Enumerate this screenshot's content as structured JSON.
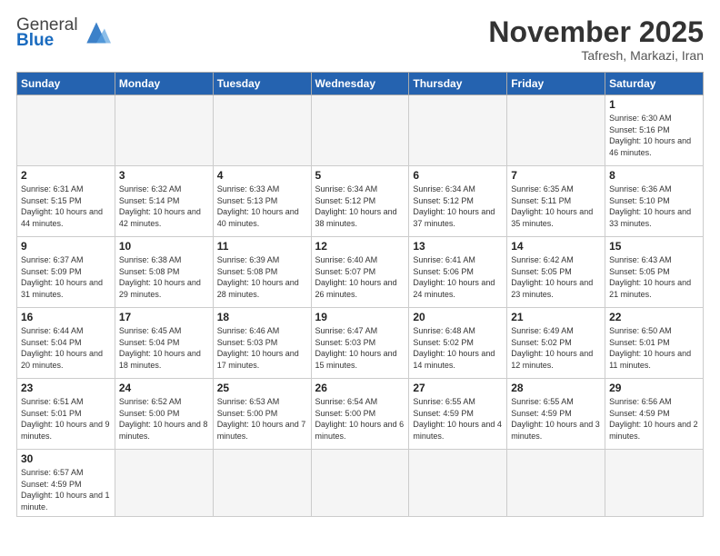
{
  "header": {
    "logo": {
      "general": "General",
      "blue": "Blue"
    },
    "month": "November 2025",
    "location": "Tafresh, Markazi, Iran"
  },
  "weekdays": [
    "Sunday",
    "Monday",
    "Tuesday",
    "Wednesday",
    "Thursday",
    "Friday",
    "Saturday"
  ],
  "weeks": [
    [
      {
        "day": "",
        "info": ""
      },
      {
        "day": "",
        "info": ""
      },
      {
        "day": "",
        "info": ""
      },
      {
        "day": "",
        "info": ""
      },
      {
        "day": "",
        "info": ""
      },
      {
        "day": "",
        "info": ""
      },
      {
        "day": "1",
        "info": "Sunrise: 6:30 AM\nSunset: 5:16 PM\nDaylight: 10 hours\nand 46 minutes."
      }
    ],
    [
      {
        "day": "2",
        "info": "Sunrise: 6:31 AM\nSunset: 5:15 PM\nDaylight: 10 hours\nand 44 minutes."
      },
      {
        "day": "3",
        "info": "Sunrise: 6:32 AM\nSunset: 5:14 PM\nDaylight: 10 hours\nand 42 minutes."
      },
      {
        "day": "4",
        "info": "Sunrise: 6:33 AM\nSunset: 5:13 PM\nDaylight: 10 hours\nand 40 minutes."
      },
      {
        "day": "5",
        "info": "Sunrise: 6:34 AM\nSunset: 5:12 PM\nDaylight: 10 hours\nand 38 minutes."
      },
      {
        "day": "6",
        "info": "Sunrise: 6:34 AM\nSunset: 5:12 PM\nDaylight: 10 hours\nand 37 minutes."
      },
      {
        "day": "7",
        "info": "Sunrise: 6:35 AM\nSunset: 5:11 PM\nDaylight: 10 hours\nand 35 minutes."
      },
      {
        "day": "8",
        "info": "Sunrise: 6:36 AM\nSunset: 5:10 PM\nDaylight: 10 hours\nand 33 minutes."
      }
    ],
    [
      {
        "day": "9",
        "info": "Sunrise: 6:37 AM\nSunset: 5:09 PM\nDaylight: 10 hours\nand 31 minutes."
      },
      {
        "day": "10",
        "info": "Sunrise: 6:38 AM\nSunset: 5:08 PM\nDaylight: 10 hours\nand 29 minutes."
      },
      {
        "day": "11",
        "info": "Sunrise: 6:39 AM\nSunset: 5:08 PM\nDaylight: 10 hours\nand 28 minutes."
      },
      {
        "day": "12",
        "info": "Sunrise: 6:40 AM\nSunset: 5:07 PM\nDaylight: 10 hours\nand 26 minutes."
      },
      {
        "day": "13",
        "info": "Sunrise: 6:41 AM\nSunset: 5:06 PM\nDaylight: 10 hours\nand 24 minutes."
      },
      {
        "day": "14",
        "info": "Sunrise: 6:42 AM\nSunset: 5:05 PM\nDaylight: 10 hours\nand 23 minutes."
      },
      {
        "day": "15",
        "info": "Sunrise: 6:43 AM\nSunset: 5:05 PM\nDaylight: 10 hours\nand 21 minutes."
      }
    ],
    [
      {
        "day": "16",
        "info": "Sunrise: 6:44 AM\nSunset: 5:04 PM\nDaylight: 10 hours\nand 20 minutes."
      },
      {
        "day": "17",
        "info": "Sunrise: 6:45 AM\nSunset: 5:04 PM\nDaylight: 10 hours\nand 18 minutes."
      },
      {
        "day": "18",
        "info": "Sunrise: 6:46 AM\nSunset: 5:03 PM\nDaylight: 10 hours\nand 17 minutes."
      },
      {
        "day": "19",
        "info": "Sunrise: 6:47 AM\nSunset: 5:03 PM\nDaylight: 10 hours\nand 15 minutes."
      },
      {
        "day": "20",
        "info": "Sunrise: 6:48 AM\nSunset: 5:02 PM\nDaylight: 10 hours\nand 14 minutes."
      },
      {
        "day": "21",
        "info": "Sunrise: 6:49 AM\nSunset: 5:02 PM\nDaylight: 10 hours\nand 12 minutes."
      },
      {
        "day": "22",
        "info": "Sunrise: 6:50 AM\nSunset: 5:01 PM\nDaylight: 10 hours\nand 11 minutes."
      }
    ],
    [
      {
        "day": "23",
        "info": "Sunrise: 6:51 AM\nSunset: 5:01 PM\nDaylight: 10 hours\nand 9 minutes."
      },
      {
        "day": "24",
        "info": "Sunrise: 6:52 AM\nSunset: 5:00 PM\nDaylight: 10 hours\nand 8 minutes."
      },
      {
        "day": "25",
        "info": "Sunrise: 6:53 AM\nSunset: 5:00 PM\nDaylight: 10 hours\nand 7 minutes."
      },
      {
        "day": "26",
        "info": "Sunrise: 6:54 AM\nSunset: 5:00 PM\nDaylight: 10 hours\nand 6 minutes."
      },
      {
        "day": "27",
        "info": "Sunrise: 6:55 AM\nSunset: 4:59 PM\nDaylight: 10 hours\nand 4 minutes."
      },
      {
        "day": "28",
        "info": "Sunrise: 6:55 AM\nSunset: 4:59 PM\nDaylight: 10 hours\nand 3 minutes."
      },
      {
        "day": "29",
        "info": "Sunrise: 6:56 AM\nSunset: 4:59 PM\nDaylight: 10 hours\nand 2 minutes."
      }
    ],
    [
      {
        "day": "30",
        "info": "Sunrise: 6:57 AM\nSunset: 4:59 PM\nDaylight: 10 hours\nand 1 minute."
      },
      {
        "day": "",
        "info": ""
      },
      {
        "day": "",
        "info": ""
      },
      {
        "day": "",
        "info": ""
      },
      {
        "day": "",
        "info": ""
      },
      {
        "day": "",
        "info": ""
      },
      {
        "day": "",
        "info": ""
      }
    ]
  ]
}
